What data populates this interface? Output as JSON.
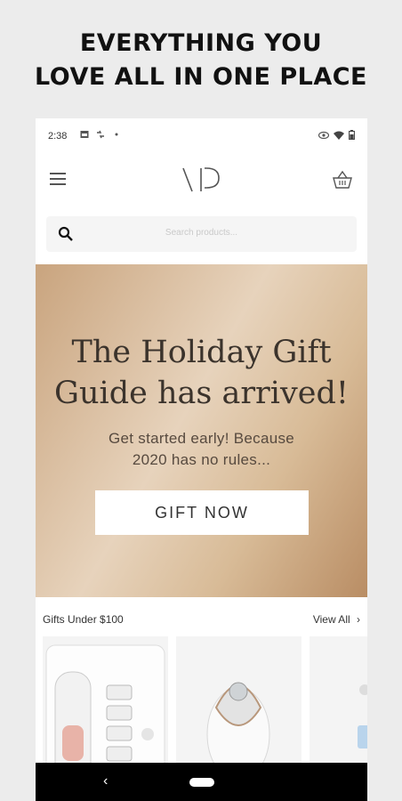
{
  "promo": {
    "line1": "EVERYTHING YOU",
    "line2": "LOVE ALL IN ONE PLACE"
  },
  "status": {
    "time": "2:38"
  },
  "header": {
    "logo_icon": "vp-logo",
    "menu_icon": "hamburger-icon",
    "cart_icon": "basket-icon"
  },
  "search": {
    "placeholder": "Search products..."
  },
  "hero": {
    "title_line1": "The Holiday Gift",
    "title_line2": "Guide has arrived!",
    "subtitle_line1": "Get started early! Because",
    "subtitle_line2": "2020 has no rules...",
    "button": "GIFT NOW"
  },
  "section": {
    "title": "Gifts Under $100",
    "view_all": "View All"
  },
  "products": [
    {
      "image": "facial-device-kit"
    },
    {
      "image": "facial-steamer"
    },
    {
      "image": "product-partial"
    }
  ],
  "nav": {
    "back": "‹"
  },
  "colors": {
    "hero_gold": "#d8bb97",
    "hero_text": "#3b332c"
  }
}
